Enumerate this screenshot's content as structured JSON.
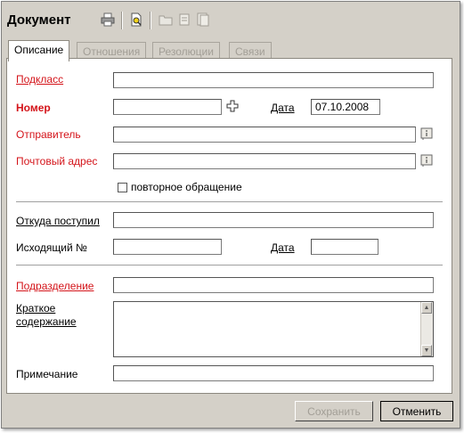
{
  "window": {
    "title": "Документ"
  },
  "toolbar": {
    "icons": [
      "printer-icon",
      "find-document-icon",
      "folder-icon",
      "copy-icon",
      "paste-icon"
    ]
  },
  "tabs": [
    {
      "label": "Описание",
      "active": true
    },
    {
      "label": "Отношения",
      "active": false
    },
    {
      "label": "Резолюции",
      "active": false
    },
    {
      "label": "Связи",
      "active": false
    }
  ],
  "form": {
    "subclass": {
      "label": "Подкласс",
      "value": ""
    },
    "number": {
      "label": "Номер",
      "value": ""
    },
    "date": {
      "label": "Дата",
      "value": "07.10.2008"
    },
    "sender": {
      "label": "Отправитель",
      "value": ""
    },
    "postal_address": {
      "label": "Почтовый адрес",
      "value": ""
    },
    "repeat_request": {
      "label": "повторное обращение",
      "checked": false
    },
    "received_from": {
      "label": "Откуда поступил",
      "value": ""
    },
    "outgoing_number": {
      "label": "Исходящий №",
      "value": ""
    },
    "outgoing_date": {
      "label": "Дата",
      "value": ""
    },
    "department": {
      "label": "Подразделение",
      "value": ""
    },
    "summary": {
      "label_line1": "Краткое",
      "label_line2": "содержание",
      "value": ""
    },
    "note": {
      "label": "Примечание",
      "value": ""
    }
  },
  "buttons": {
    "save": "Сохранить",
    "cancel": "Отменить",
    "save_enabled": false
  },
  "colors": {
    "required_label": "#d4141a",
    "window_bg": "#d4d0c8",
    "disabled_text": "#a29e96"
  }
}
